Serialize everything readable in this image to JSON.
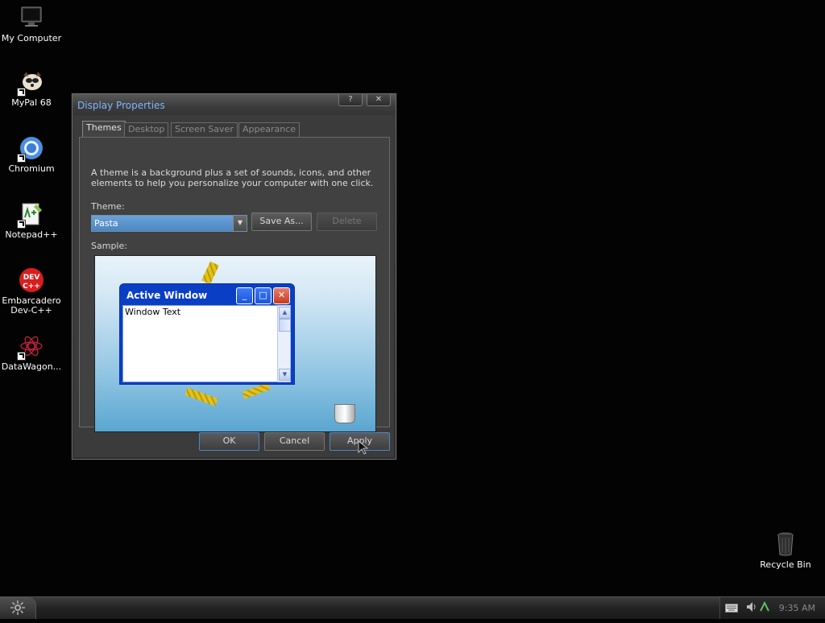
{
  "desktop": {
    "icons": [
      {
        "label": "My Computer",
        "icon": "my-computer-icon"
      },
      {
        "label": "MyPal 68",
        "icon": "mypal-icon"
      },
      {
        "label": "Chromium",
        "icon": "chromium-icon"
      },
      {
        "label": "Notepad++",
        "icon": "notepadpp-icon"
      },
      {
        "label": "Embarcadero Dev-C++",
        "icon": "devcpp-icon"
      },
      {
        "label": "DataWagon...",
        "icon": "datawagon-icon"
      }
    ],
    "recycle_bin": {
      "label": "Recycle Bin",
      "icon": "recycle-bin-icon"
    }
  },
  "dialog": {
    "title": "Display Properties",
    "help_button": "?",
    "close_button": "✕",
    "tabs": [
      {
        "label": "Themes",
        "active": true
      },
      {
        "label": "Desktop",
        "active": false
      },
      {
        "label": "Screen Saver",
        "active": false
      },
      {
        "label": "Appearance",
        "active": false
      }
    ],
    "description": "A theme is a background plus a set of sounds, icons, and other elements to help you personalize your computer with one click.",
    "theme_label": "Theme:",
    "theme_value": "Pasta",
    "save_as_label": "Save As...",
    "delete_label": "Delete",
    "sample_label": "Sample:",
    "sample": {
      "window_title": "Active Window",
      "window_text": "Window Text"
    },
    "ok_label": "OK",
    "cancel_label": "Cancel",
    "apply_label": "Apply"
  },
  "taskbar": {
    "start_icon": "start-icon",
    "clock": "9:35 AM"
  },
  "colors": {
    "desktop_bg": "#030303",
    "title_text": "#7fb5ff",
    "selection": "#5a95cf",
    "sample_window_blue": "#0a3fc5"
  }
}
